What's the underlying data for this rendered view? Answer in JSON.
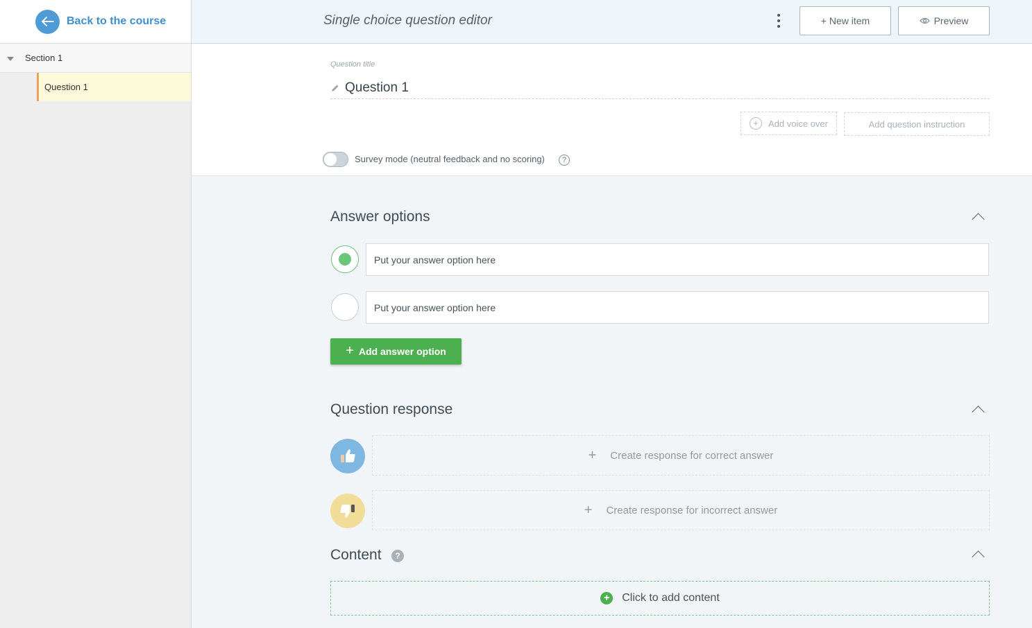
{
  "sidebar": {
    "back_label": "Back to the course",
    "section_label": "Section 1",
    "question_label": "Question 1"
  },
  "topbar": {
    "title": "Single choice question editor",
    "new_item_label": "+ New item",
    "preview_label": "Preview"
  },
  "question": {
    "title_label": "Question title",
    "title": "Question 1",
    "add_voice_label": "Add voice over",
    "add_instruction_label": "Add question instruction",
    "survey_mode_label": "Survey mode (neutral feedback and no scoring)",
    "survey_mode_on": false
  },
  "answers": {
    "heading": "Answer options",
    "options": [
      {
        "text": "Put your answer option here",
        "selected": true
      },
      {
        "text": "Put your answer option here",
        "selected": false
      }
    ],
    "add_label": "Add answer option"
  },
  "response": {
    "heading": "Question response",
    "correct_label": "Create response for correct answer",
    "incorrect_label": "Create response for incorrect answer"
  },
  "content": {
    "heading": "Content",
    "help_glyph": "?",
    "add_label": "Click to add content"
  },
  "colors": {
    "accent_blue": "#3f8fcd",
    "add_green": "#4caf50",
    "active_item_bg": "#fdf9db",
    "active_item_border": "#f0a15a"
  }
}
